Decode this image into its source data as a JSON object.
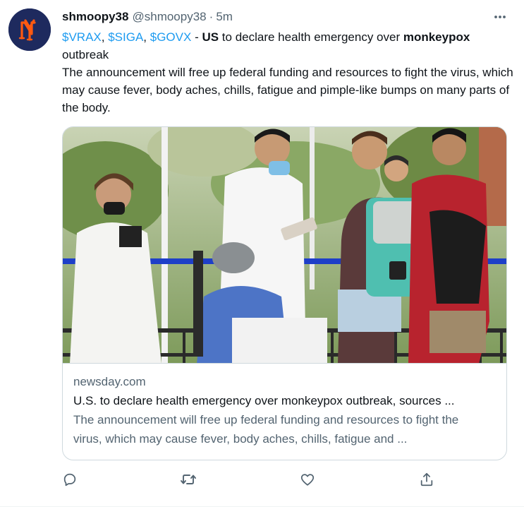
{
  "user": {
    "display_name": "shmoopy38",
    "handle": "@shmoopy38",
    "separator": "·",
    "time": "5m",
    "avatar_icon": "mets-logo-icon",
    "avatar_bg": "#1e2a5e",
    "avatar_fg": "#ff5910"
  },
  "tweet": {
    "line1": {
      "tag1": "$VRAX",
      "comma1": ", ",
      "tag2": "$SIGA",
      "comma2": ", ",
      "tag3": "$GOVX",
      "dash": " - ",
      "us": "US",
      "mid": " to declare health emergency over ",
      "keyword": "monkeypox",
      "tail": " outbreak"
    },
    "body": "The announcement will free up federal funding and resources to fight the virus, which may cause fever, body aches, chills, fatigue and pimple-like bumps on many parts of the body."
  },
  "card": {
    "domain": "newsday.com",
    "title": "U.S. to declare health emergency over monkeypox outbreak, sources ...",
    "description": "The announcement will free up federal funding and resources to fight the virus, which may cause fever, body aches, chills, fatigue and ..."
  },
  "actions": [
    {
      "icon": "reply-icon"
    },
    {
      "icon": "retweet-icon"
    },
    {
      "icon": "like-icon"
    },
    {
      "icon": "share-icon"
    }
  ],
  "colors": {
    "link": "#1d9bf0",
    "secondary": "#536471",
    "border": "#cfd9de"
  }
}
